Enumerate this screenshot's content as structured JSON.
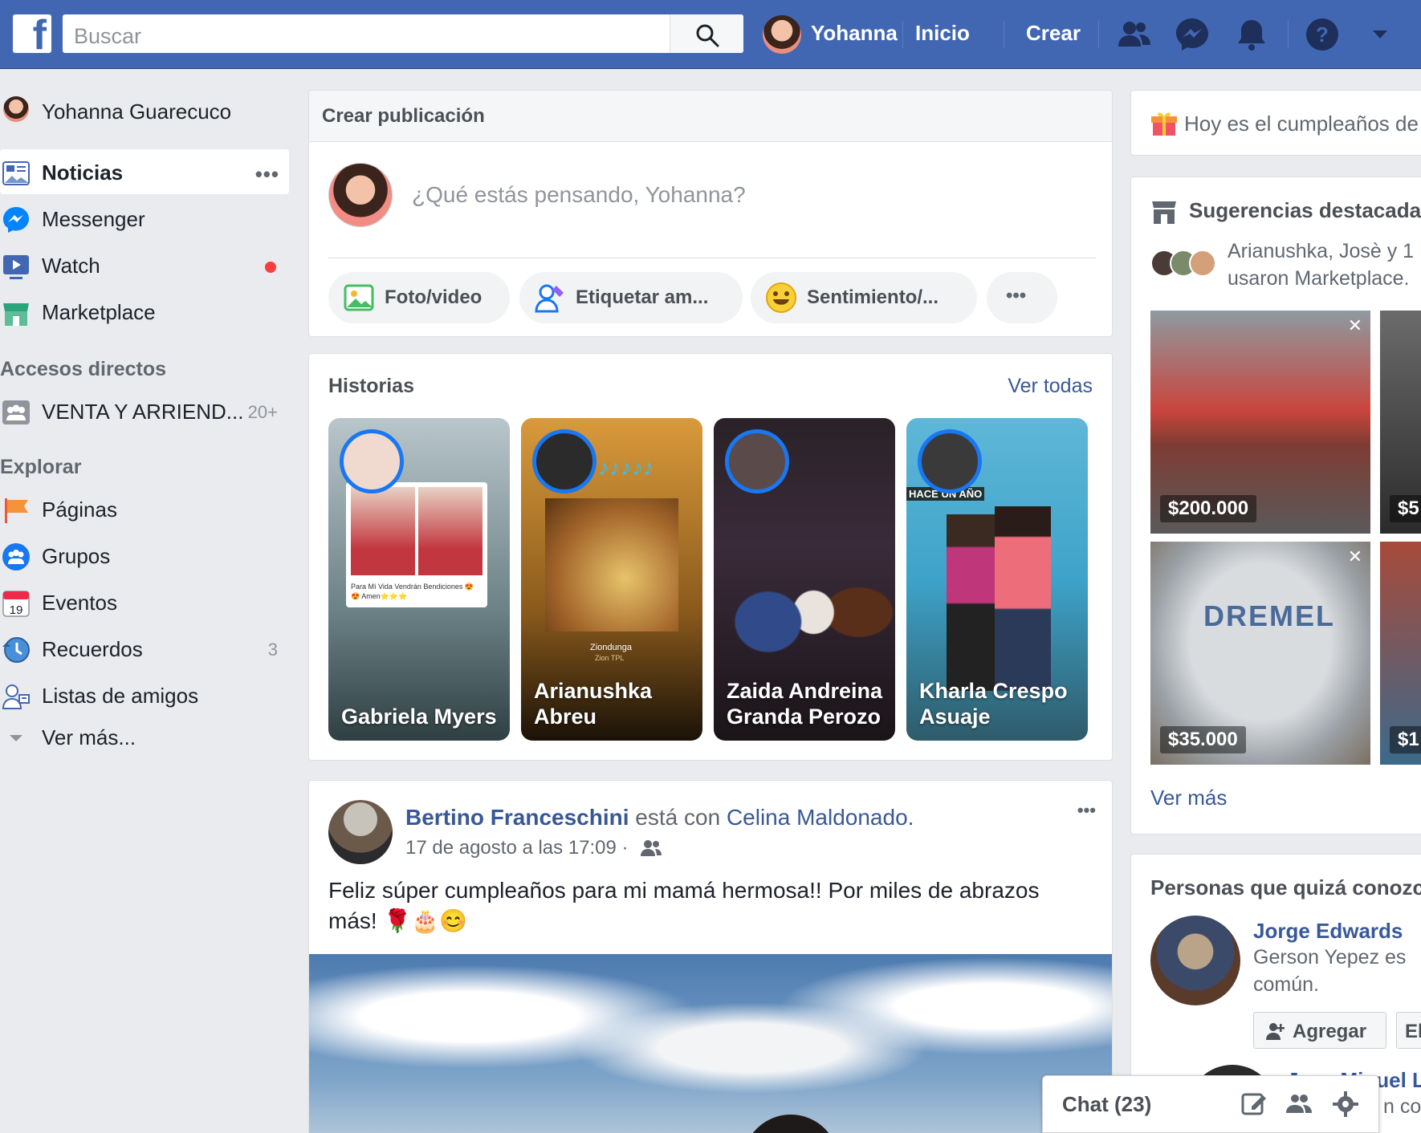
{
  "topbar": {
    "logo": "f",
    "search_placeholder": "Buscar",
    "user_name": "Yohanna",
    "links": [
      "Inicio",
      "Crear"
    ]
  },
  "sidebar": {
    "profile_name": "Yohanna Guarecuco",
    "items": [
      {
        "label": "Noticias",
        "icon": "news-feed-icon"
      },
      {
        "label": "Messenger",
        "icon": "messenger-icon"
      },
      {
        "label": "Watch",
        "icon": "watch-icon"
      },
      {
        "label": "Marketplace",
        "icon": "marketplace-icon"
      }
    ],
    "shortcuts_title": "Accesos directos",
    "shortcut": {
      "label": "VENTA Y ARRIEND...",
      "badge": "20+"
    },
    "explore_title": "Explorar",
    "explore": [
      {
        "label": "Páginas",
        "icon": "pages-flag-icon"
      },
      {
        "label": "Grupos",
        "icon": "groups-icon"
      },
      {
        "label": "Eventos",
        "icon": "events-calendar-icon",
        "calendar_day": "19"
      },
      {
        "label": "Recuerdos",
        "icon": "memories-clock-icon",
        "badge": "3"
      },
      {
        "label": "Listas de amigos",
        "icon": "friend-lists-icon"
      }
    ],
    "see_more": "Ver más..."
  },
  "composer": {
    "title": "Crear publicación",
    "placeholder": "¿Qué estás pensando, Yohanna?",
    "actions": [
      "Foto/video",
      "Etiquetar am...",
      "Sentimiento/..."
    ]
  },
  "stories": {
    "title": "Historias",
    "see_all": "Ver todas",
    "items": [
      {
        "name": "Gabriela Myers",
        "caption": "Para Mí Vida Vendrán Bendiciones 😍😍 Amen⭐⭐⭐"
      },
      {
        "name": "Arianushka Abreu",
        "caption": "Ziondunga",
        "subcaption": "Zion TPL"
      },
      {
        "name": "Zaida Andreina Granda Perozo"
      },
      {
        "name": "Kharla Crespo Asuaje",
        "caption": "HACE UN AÑO"
      }
    ]
  },
  "post": {
    "author": "Bertino Franceschini",
    "with_text": "está con",
    "tagged": "Celina Maldonado",
    "timestamp": "17 de agosto a las 17:09 ·",
    "body": "Feliz súper cumpleaños para mi mamá hermosa!! Por miles de abrazos más! 🌹🎂😊"
  },
  "right": {
    "birthday": "Hoy es el cumpleaños de",
    "suggestions_title": "Sugerencias destacadas",
    "suggestions_text_1": "Arianushka, Josè y 1",
    "suggestions_text_2": "usaron Marketplace.",
    "products": [
      {
        "price": "$200.000"
      },
      {
        "price": "$5"
      },
      {
        "price": "$35.000",
        "brand": "DREMEL"
      },
      {
        "price": "$1"
      }
    ],
    "see_more": "Ver más",
    "people_title": "Personas que quizá conozca",
    "person": {
      "name": "Jorge Edwards",
      "mutual_1": "Gerson Yepez es",
      "mutual_2": "común.",
      "add": "Agregar",
      "remove_partial": "El"
    },
    "person2_name": "Jose Miguel Lg",
    "person2_partial": "n com"
  },
  "chat": {
    "label": "Chat (23)"
  },
  "colors": {
    "brand": "#4267b2",
    "link": "#385898",
    "background": "#e9ebee"
  }
}
